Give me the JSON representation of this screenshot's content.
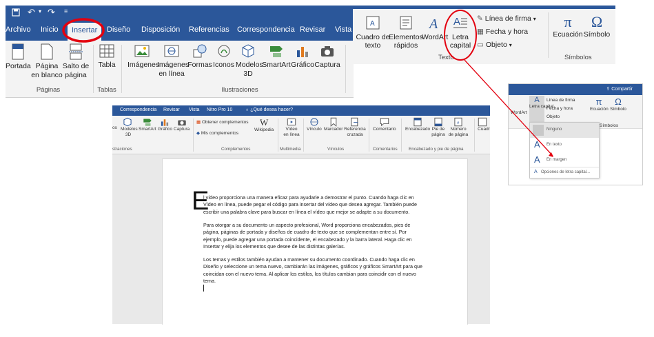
{
  "panel_top_left": {
    "tabs": [
      "Archivo",
      "Inicio",
      "Insertar",
      "Diseño",
      "Disposición",
      "Referencias",
      "Correspondencia",
      "Revisar",
      "Vista"
    ],
    "active_tab": "Insertar",
    "buttons": {
      "portada": "Portada",
      "pagina_en_blanco": "Página en blanco",
      "salto_de_pagina": "Salto de página",
      "tabla": "Tabla",
      "imagenes": "Imágenes",
      "imagenes_en_linea": "Imágenes en línea",
      "formas": "Formas",
      "iconos": "Iconos",
      "modelos_3d": "Modelos 3D",
      "smartart": "SmartArt",
      "grafico": "Gráfico",
      "captura": "Captura"
    },
    "groups": {
      "paginas": "Páginas",
      "tablas": "Tablas",
      "ilustraciones": "Ilustraciones"
    },
    "highlight_color": "#e3000f"
  },
  "panel_top_right": {
    "buttons": {
      "cuadro_de_texto": "Cuadro de texto",
      "elementos_rapidos": "Elementos rápidos",
      "wordart": "WordArt",
      "letra_capital": "Letra capital",
      "linea_de_firma": "Línea de firma",
      "fecha_y_hora": "Fecha y hora",
      "objeto": "Objeto",
      "ecuacion": "Ecuación",
      "simbolo": "Símbolo"
    },
    "groups": {
      "texto": "Texto",
      "simbolos": "Símbolos"
    }
  },
  "panel_dropdown": {
    "share": "Compartir",
    "buttons": {
      "wordart": "WordArt",
      "letra_capital": "Letra capital",
      "linea_de_firma": "Línea de firma",
      "fecha_y_hora": "Fecha y hora",
      "objeto": "Objeto",
      "ecuacion": "Ecuación",
      "simbolo": "Símbolo"
    },
    "group_simbolos": "Símbolos",
    "menu": [
      "Ninguno",
      "En texto",
      "En margen",
      "Opciones de letra capital..."
    ]
  },
  "panel_document": {
    "tabs": [
      "Correspondencia",
      "Revisar",
      "Vista",
      "Nitro Pro 10",
      "¿Qué desea hacer?"
    ],
    "ribbon": {
      "modelos_3d": "Modelos 3D",
      "smartart": "SmartArt",
      "grafico": "Gráfico",
      "captura": "Captura",
      "obtener_complementos": "Obtener complementos",
      "mis_complementos": "Mis complementos",
      "wikipedia": "Wikipedia",
      "video_en_linea": "Vídeo en línea",
      "vinculo": "Vínculo",
      "marcador": "Marcador",
      "referencia_cruzada": "Referencia cruzada",
      "comentario": "Comentario",
      "encabezado": "Encabezado",
      "pie_de_pagina": "Pie de página",
      "numero_de_pagina": "Número de página",
      "cuadro_de_texto": "Cuadro de texto"
    },
    "groups": {
      "ilustraciones": "Ilustraciones",
      "complementos": "Complementos",
      "multimedia": "Multimedia",
      "vinculos": "Vínculos",
      "comentarios": "Comentarios",
      "encabezado_pie": "Encabezado y pie de página"
    },
    "drop_cap": "E",
    "paragraphs": [
      "l vídeo proporciona una manera eficaz para ayudarle a demostrar el punto. Cuando haga clic en Vídeo en línea, puede pegar el código para insertar del vídeo que desea agregar. También puede escribir una palabra clave para buscar en línea el vídeo que mejor se adapte a su documento.",
      "Para otorgar a su documento un aspecto profesional, Word proporciona encabezados, pies de página, páginas de portada y diseños de cuadro de texto que se complementan entre sí. Por ejemplo, puede agregar una portada coincidente, el encabezado y la barra lateral. Haga clic en Insertar y elija los elementos que desee de las distintas galerías.",
      "Los temas y estilos también ayudan a mantener su documento coordinado. Cuando haga clic en Diseño y seleccione un tema nuevo, cambiarán las imágenes, gráficos y gráficos SmartArt para que coincidan con el nuevo tema. Al aplicar los estilos, los títulos cambian para coincidir con el nuevo tema."
    ]
  },
  "colors": {
    "ribbon_blue": "#2b579a",
    "ribbon_bg": "#f3f3f3",
    "annotation_red": "#e3000f"
  }
}
